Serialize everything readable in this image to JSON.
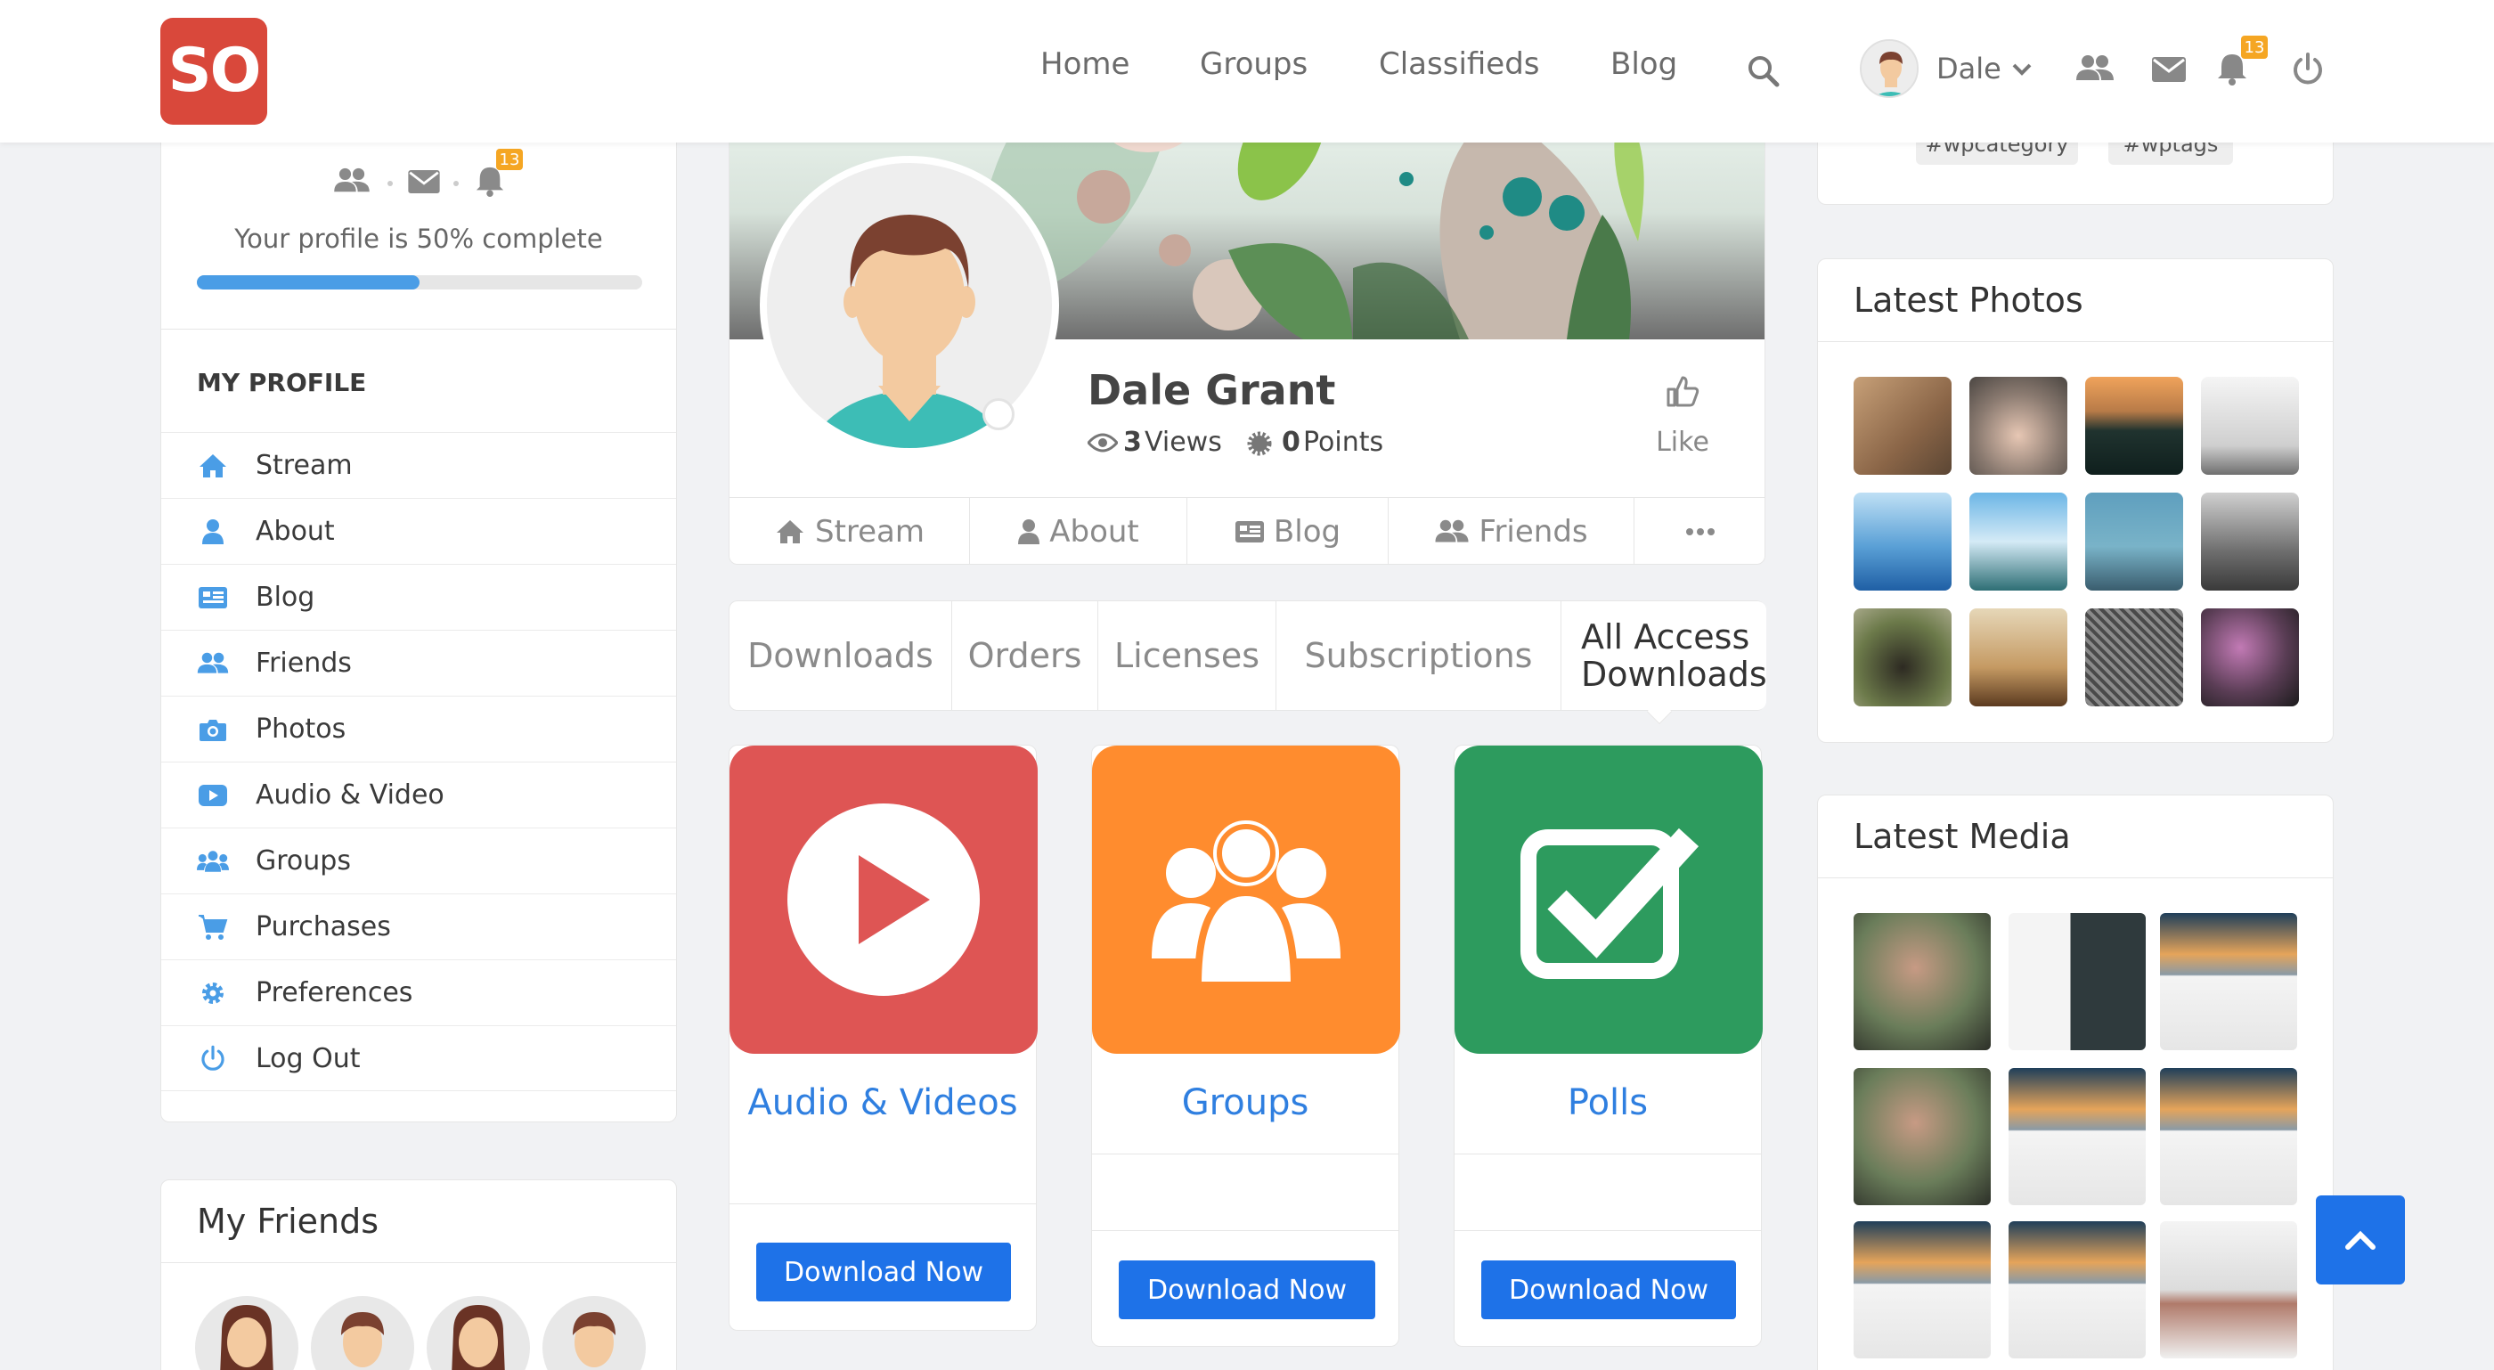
{
  "header": {
    "logo_text": "so",
    "nav": [
      "Home",
      "Groups",
      "Classifieds",
      "Blog"
    ],
    "user_name": "Dale",
    "notification_count": "13"
  },
  "sidebar": {
    "notification_count": "13",
    "profile_complete_text": "Your profile is 50% complete",
    "profile_complete_percent": 50,
    "section_title": "MY PROFILE",
    "items": [
      {
        "label": "Stream",
        "icon": "home-icon"
      },
      {
        "label": "About",
        "icon": "user-icon"
      },
      {
        "label": "Blog",
        "icon": "blog-icon"
      },
      {
        "label": "Friends",
        "icon": "friends-icon"
      },
      {
        "label": "Photos",
        "icon": "camera-icon"
      },
      {
        "label": "Audio & Video",
        "icon": "video-icon"
      },
      {
        "label": "Groups",
        "icon": "groups-icon"
      },
      {
        "label": "Purchases",
        "icon": "cart-icon"
      },
      {
        "label": "Preferences",
        "icon": "gear-icon"
      },
      {
        "label": "Log Out",
        "icon": "power-icon"
      }
    ],
    "friends_title": "My Friends"
  },
  "profile": {
    "name": "Dale Grant",
    "views_count": "3",
    "views_label": "Views",
    "points_count": "0",
    "points_label": "Points",
    "like_label": "Like",
    "tabs": [
      "Stream",
      "About",
      "Blog",
      "Friends"
    ]
  },
  "downloads": {
    "tabs": [
      "Downloads",
      "Orders",
      "Licenses",
      "Subscriptions",
      "All Access Downloads"
    ],
    "active_tab": "All Access Downloads",
    "products": [
      {
        "title": "Audio & Videos",
        "button": "Download Now",
        "color": "#de5554"
      },
      {
        "title": "Groups",
        "button": "Download Now",
        "color": "#ff8c2e"
      },
      {
        "title": "Polls",
        "button": "Download Now",
        "color": "#2d9b5e"
      }
    ]
  },
  "right": {
    "tags": [
      "#wpcategory",
      "#wptags"
    ],
    "latest_photos_title": "Latest Photos",
    "latest_media_title": "Latest Media"
  },
  "colors": {
    "accent": "#1e72e8",
    "brand": "#d9483b",
    "icon_blue": "#4a9de6",
    "badge": "#f5a623"
  }
}
